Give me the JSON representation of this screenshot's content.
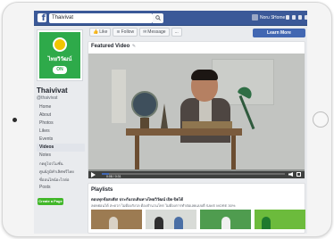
{
  "facebook": {
    "logo_letter": "f",
    "search_value": "Thaivivat",
    "user_name": "Noru S",
    "home_label": "Home"
  },
  "page": {
    "name": "Thaivivat",
    "handle": "@thaivivat",
    "logo_text": "ไทยวิวัฒน์",
    "logo_badge": "ON"
  },
  "nav": {
    "items": [
      "Home",
      "About",
      "Photos",
      "Likes",
      "Events",
      "Videos",
      "Notes",
      "กดดูโปรโมชั่น",
      "ศูนย์ภูมิคำเลิศฟรีไทย",
      "ซี่ออนไลน์อะไรต่อ",
      "Posts"
    ],
    "active": "Videos",
    "create_page_label": "Create a Page"
  },
  "actions": {
    "like_label": "Like",
    "follow_label": "Follow",
    "message_label": "Message",
    "more_label": "...",
    "learn_more_label": "Learn More"
  },
  "featured_video": {
    "title": "Featured Video",
    "timecode": "0:08 / 0:31",
    "progress": 0.04
  },
  "playlists": {
    "title": "Playlists",
    "subtitle": "ตอบทุกข้อสงสัย! ประกันรถเดินทางไทยวิวัฒน์ เปิด-ปิดได้",
    "description": "ลดหย่อนได้ สะดวก ไม่ต้องกังวล ต้องจำนวนโทร ไม่ต้องการทำต่อเลยแบบดี SAVE MORE 30%"
  },
  "colors": {
    "fb_blue": "#3b5998",
    "learn_more": "#4267b2",
    "brand_green": "#2eaa4a",
    "create_green": "#42b72a"
  }
}
